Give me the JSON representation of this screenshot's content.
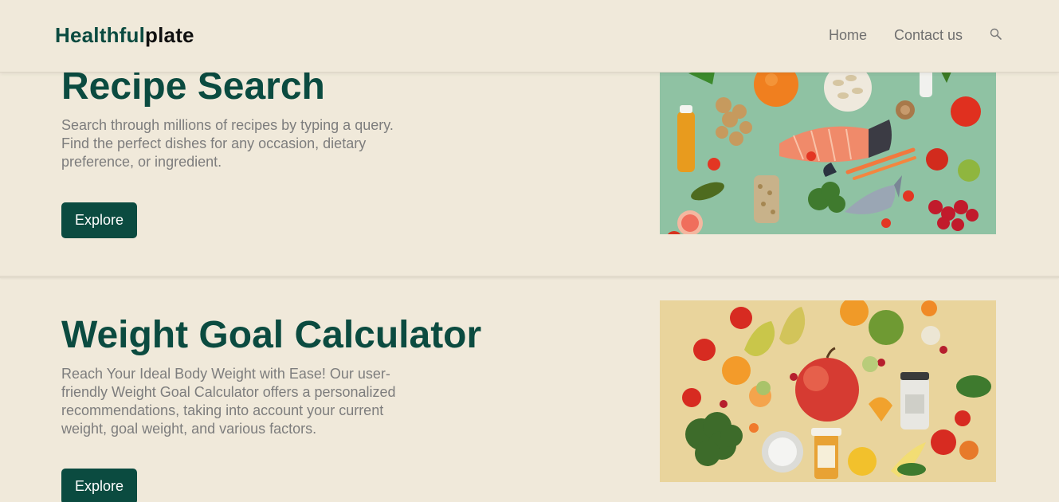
{
  "brand": {
    "part1": "Healthful",
    "part2": "plate"
  },
  "nav": {
    "home": "Home",
    "contact": "Contact us"
  },
  "icons": {
    "search": "search-icon"
  },
  "colors": {
    "background": "#f0e9da",
    "accent": "#0b4b40",
    "text_muted": "#7d7d7d"
  },
  "sections": [
    {
      "title": "Recipe Search",
      "description": "Search through millions of recipes by typing a query. Find the perfect dishes for any occasion, dietary preference, or ingredient.",
      "button": "Explore"
    },
    {
      "title": "Weight Goal Calculator",
      "description": "Reach Your Ideal Body Weight with Ease! Our user-friendly Weight Goal Calculator offers a personalized recommendations, taking into account your current weight, goal weight, and various factors.",
      "button": "Explore"
    }
  ]
}
